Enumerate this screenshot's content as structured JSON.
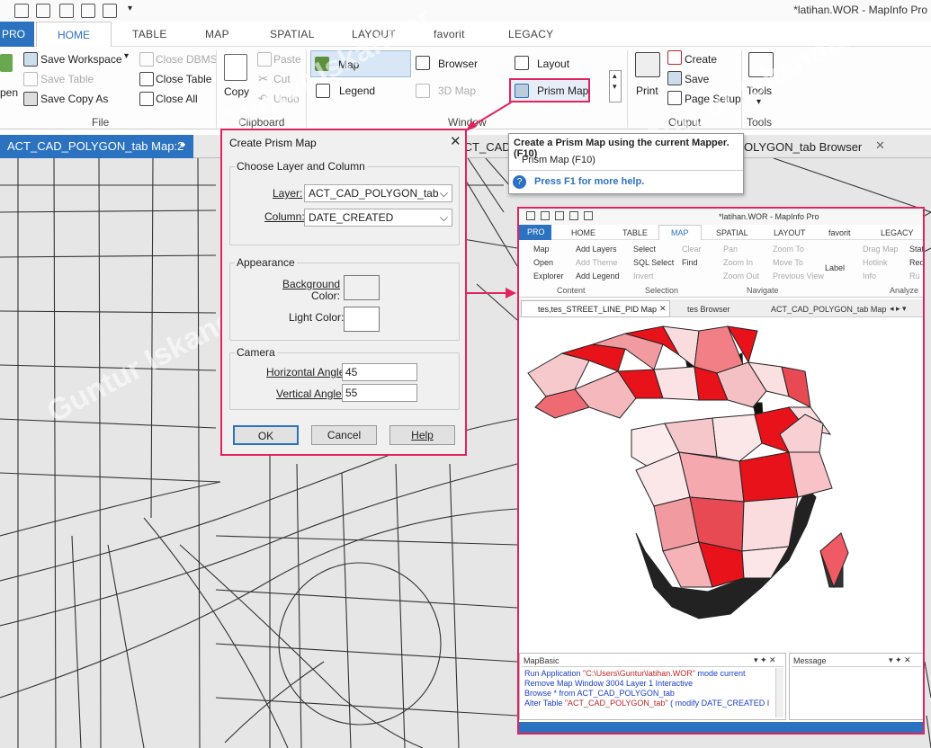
{
  "window_title": "*latihan.WOR - MapInfo Pro",
  "ribbon_tabs": [
    "PRO",
    "HOME",
    "TABLE",
    "MAP",
    "SPATIAL",
    "LAYOUT",
    "favorit",
    "LEGACY"
  ],
  "file_group": {
    "label": "File",
    "open": "pen",
    "save_workspace": "Save Workspace",
    "save_table": "Save Table",
    "save_copy_as": "Save Copy As",
    "close_dbms": "Close DBMS",
    "close_table": "Close Table",
    "close_all": "Close All"
  },
  "clipboard_group": {
    "label": "Clipboard",
    "copy": "Copy",
    "paste": "Paste",
    "cut": "Cut",
    "undo": "Undo"
  },
  "window_group": {
    "label": "Window",
    "map": "Map",
    "legend": "Legend",
    "browser": "Browser",
    "map3d": "3D Map",
    "layout": "Layout",
    "prism_map": "Prism Map"
  },
  "output_group": {
    "label": "Output",
    "print": "Print",
    "create": "Create",
    "save": "Save",
    "page_setup": "Page Setup"
  },
  "tools_group": {
    "label": "Tools",
    "tools": "Tools"
  },
  "doc_tabs": {
    "active": "ACT_CAD_POLYGON_tab Map:2",
    "mid": "ACT_CAD",
    "right": "OLYGON_tab Browser"
  },
  "dialog": {
    "title": "Create Prism Map",
    "section_layer": "Choose Layer and Column",
    "layer_label": "Layer:",
    "layer_value": "ACT_CAD_POLYGON_tab",
    "column_label": "Column:",
    "column_value": "DATE_CREATED",
    "section_appearance": "Appearance",
    "background_label_1": "Background",
    "background_label_2": "Color:",
    "light_label": "Light Color:",
    "section_camera": "Camera",
    "h_angle_label": "Horizontal Angle:",
    "h_angle_value": "45",
    "v_angle_label": "Vertical Angle:",
    "v_angle_value": "55",
    "ok": "OK",
    "cancel": "Cancel",
    "help": "Help"
  },
  "tooltip": {
    "title": "Create a Prism Map using the current Mapper. (F10)",
    "item": "Prism Map (F10)",
    "help": "Press F1 for more help."
  },
  "inset": {
    "title": "*latihan.WOR - MapInfo Pro",
    "tabs": [
      "PRO",
      "HOME",
      "TABLE",
      "MAP",
      "SPATIAL",
      "LAYOUT",
      "favorit",
      "LEGACY"
    ],
    "content": {
      "map": "Map",
      "open": "Open",
      "explorer": "Explorer",
      "add_layers": "Add Layers",
      "add_theme": "Add Theme",
      "add_legend": "Add Legend",
      "label": "Content"
    },
    "selection": {
      "select": "Select",
      "clear": "Clear",
      "sql_select": "SQL Select",
      "find": "Find",
      "invert": "Invert",
      "label": "Selection"
    },
    "navigate": {
      "pan": "Pan",
      "zoom_in": "Zoom In",
      "zoom_out": "Zoom Out",
      "zoom_to": "Zoom To",
      "move_to": "Move To",
      "previous_view": "Previous View",
      "label": "Navigate"
    },
    "analyze": {
      "label_btn": "Label",
      "drag_map": "Drag Map",
      "hotlink": "Hotlink",
      "info": "Info",
      "stat": "Stat",
      "red": "Red",
      "ru": "Ru",
      "label": "Analyze"
    },
    "doc_tabs": [
      "tes,tes_STREET_LINE_PID Map",
      "tes Browser",
      "ACT_CAD_POLYGON_tab Map"
    ],
    "mapbasic_title": "MapBasic",
    "message_title": "Message",
    "mapbasic_lines": [
      {
        "a": "Run Application ",
        "b": "\"C:\\Users\\Guntur\\latihan.WOR\"",
        "c": " mode current"
      },
      {
        "a": "Remove Map Window 3004 Layer 1 Interactive",
        "b": "",
        "c": ""
      },
      {
        "a": "Browse * from ACT_CAD_POLYGON_tab",
        "b": "",
        "c": ""
      },
      {
        "a": "Alter Table ",
        "b": "\"ACT_CAD_POLYGON_tab\"",
        "c": " ( modify DATE_CREATED I"
      }
    ]
  },
  "watermark": "Guntur Iskandar",
  "colors": {
    "accent": "#2b72c0",
    "highlight": "#e0245e",
    "prism_red": "#e8121b"
  }
}
